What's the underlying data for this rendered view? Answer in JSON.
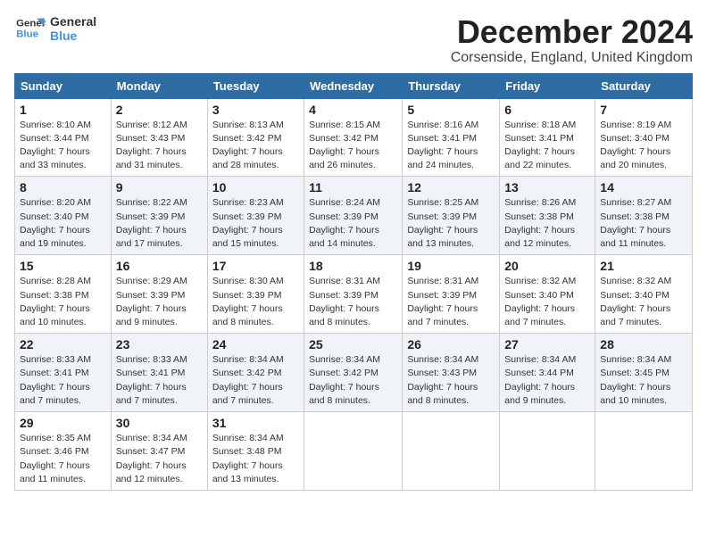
{
  "logo": {
    "line1": "General",
    "line2": "Blue"
  },
  "title": "December 2024",
  "location": "Corsenside, England, United Kingdom",
  "days_of_week": [
    "Sunday",
    "Monday",
    "Tuesday",
    "Wednesday",
    "Thursday",
    "Friday",
    "Saturday"
  ],
  "weeks": [
    [
      {
        "day": "1",
        "info": "Sunrise: 8:10 AM\nSunset: 3:44 PM\nDaylight: 7 hours\nand 33 minutes."
      },
      {
        "day": "2",
        "info": "Sunrise: 8:12 AM\nSunset: 3:43 PM\nDaylight: 7 hours\nand 31 minutes."
      },
      {
        "day": "3",
        "info": "Sunrise: 8:13 AM\nSunset: 3:42 PM\nDaylight: 7 hours\nand 28 minutes."
      },
      {
        "day": "4",
        "info": "Sunrise: 8:15 AM\nSunset: 3:42 PM\nDaylight: 7 hours\nand 26 minutes."
      },
      {
        "day": "5",
        "info": "Sunrise: 8:16 AM\nSunset: 3:41 PM\nDaylight: 7 hours\nand 24 minutes."
      },
      {
        "day": "6",
        "info": "Sunrise: 8:18 AM\nSunset: 3:41 PM\nDaylight: 7 hours\nand 22 minutes."
      },
      {
        "day": "7",
        "info": "Sunrise: 8:19 AM\nSunset: 3:40 PM\nDaylight: 7 hours\nand 20 minutes."
      }
    ],
    [
      {
        "day": "8",
        "info": "Sunrise: 8:20 AM\nSunset: 3:40 PM\nDaylight: 7 hours\nand 19 minutes."
      },
      {
        "day": "9",
        "info": "Sunrise: 8:22 AM\nSunset: 3:39 PM\nDaylight: 7 hours\nand 17 minutes."
      },
      {
        "day": "10",
        "info": "Sunrise: 8:23 AM\nSunset: 3:39 PM\nDaylight: 7 hours\nand 15 minutes."
      },
      {
        "day": "11",
        "info": "Sunrise: 8:24 AM\nSunset: 3:39 PM\nDaylight: 7 hours\nand 14 minutes."
      },
      {
        "day": "12",
        "info": "Sunrise: 8:25 AM\nSunset: 3:39 PM\nDaylight: 7 hours\nand 13 minutes."
      },
      {
        "day": "13",
        "info": "Sunrise: 8:26 AM\nSunset: 3:38 PM\nDaylight: 7 hours\nand 12 minutes."
      },
      {
        "day": "14",
        "info": "Sunrise: 8:27 AM\nSunset: 3:38 PM\nDaylight: 7 hours\nand 11 minutes."
      }
    ],
    [
      {
        "day": "15",
        "info": "Sunrise: 8:28 AM\nSunset: 3:38 PM\nDaylight: 7 hours\nand 10 minutes."
      },
      {
        "day": "16",
        "info": "Sunrise: 8:29 AM\nSunset: 3:39 PM\nDaylight: 7 hours\nand 9 minutes."
      },
      {
        "day": "17",
        "info": "Sunrise: 8:30 AM\nSunset: 3:39 PM\nDaylight: 7 hours\nand 8 minutes."
      },
      {
        "day": "18",
        "info": "Sunrise: 8:31 AM\nSunset: 3:39 PM\nDaylight: 7 hours\nand 8 minutes."
      },
      {
        "day": "19",
        "info": "Sunrise: 8:31 AM\nSunset: 3:39 PM\nDaylight: 7 hours\nand 7 minutes."
      },
      {
        "day": "20",
        "info": "Sunrise: 8:32 AM\nSunset: 3:40 PM\nDaylight: 7 hours\nand 7 minutes."
      },
      {
        "day": "21",
        "info": "Sunrise: 8:32 AM\nSunset: 3:40 PM\nDaylight: 7 hours\nand 7 minutes."
      }
    ],
    [
      {
        "day": "22",
        "info": "Sunrise: 8:33 AM\nSunset: 3:41 PM\nDaylight: 7 hours\nand 7 minutes."
      },
      {
        "day": "23",
        "info": "Sunrise: 8:33 AM\nSunset: 3:41 PM\nDaylight: 7 hours\nand 7 minutes."
      },
      {
        "day": "24",
        "info": "Sunrise: 8:34 AM\nSunset: 3:42 PM\nDaylight: 7 hours\nand 7 minutes."
      },
      {
        "day": "25",
        "info": "Sunrise: 8:34 AM\nSunset: 3:42 PM\nDaylight: 7 hours\nand 8 minutes."
      },
      {
        "day": "26",
        "info": "Sunrise: 8:34 AM\nSunset: 3:43 PM\nDaylight: 7 hours\nand 8 minutes."
      },
      {
        "day": "27",
        "info": "Sunrise: 8:34 AM\nSunset: 3:44 PM\nDaylight: 7 hours\nand 9 minutes."
      },
      {
        "day": "28",
        "info": "Sunrise: 8:34 AM\nSunset: 3:45 PM\nDaylight: 7 hours\nand 10 minutes."
      }
    ],
    [
      {
        "day": "29",
        "info": "Sunrise: 8:35 AM\nSunset: 3:46 PM\nDaylight: 7 hours\nand 11 minutes."
      },
      {
        "day": "30",
        "info": "Sunrise: 8:34 AM\nSunset: 3:47 PM\nDaylight: 7 hours\nand 12 minutes."
      },
      {
        "day": "31",
        "info": "Sunrise: 8:34 AM\nSunset: 3:48 PM\nDaylight: 7 hours\nand 13 minutes."
      },
      null,
      null,
      null,
      null
    ]
  ]
}
